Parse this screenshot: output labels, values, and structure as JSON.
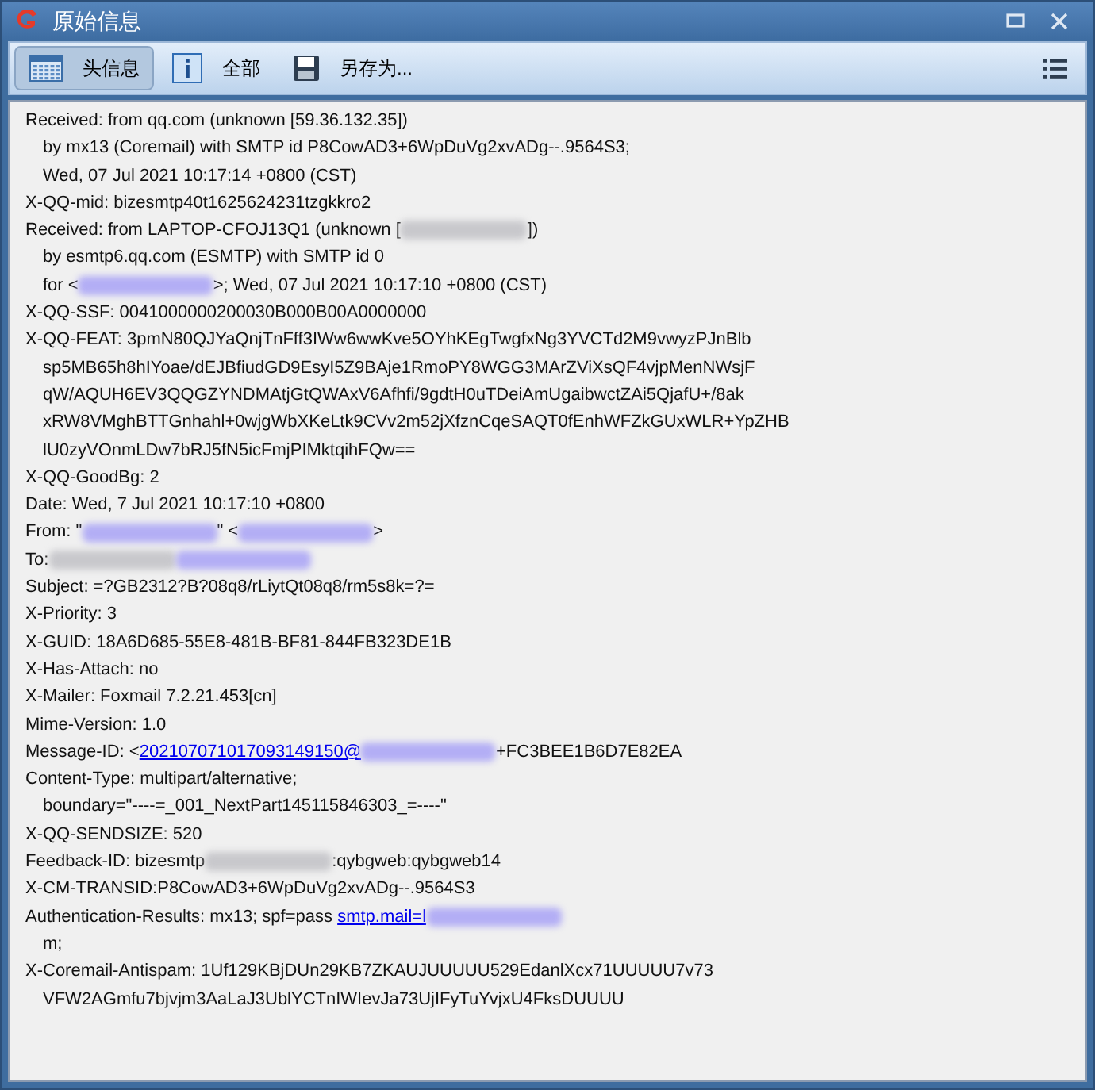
{
  "window": {
    "title": "原始信息"
  },
  "toolbar": [
    {
      "label": "头信息",
      "selected": true
    },
    {
      "label": "全部",
      "selected": false
    },
    {
      "label": "另存为...",
      "selected": false
    }
  ],
  "lines": [
    {
      "indent": false,
      "parts": [
        {
          "kind": "text",
          "text": "Received: from qq.com (unknown [59.36.132.35])"
        }
      ]
    },
    {
      "indent": true,
      "parts": [
        {
          "kind": "text",
          "text": "by mx13 (Coremail) with SMTP id P8CowAD3+6WpDuVg2xvADg--.9564S3;"
        }
      ]
    },
    {
      "indent": true,
      "parts": [
        {
          "kind": "text",
          "text": "Wed, 07 Jul 2021 10:17:14 +0800 (CST)"
        }
      ]
    },
    {
      "indent": false,
      "parts": [
        {
          "kind": "text",
          "text": "X-QQ-mid: bizesmtp40t1625624231tzgkkro2"
        }
      ]
    },
    {
      "indent": false,
      "parts": [
        {
          "kind": "text",
          "text": "Received: from LAPTOP-CFOJ13Q1 (unknown ["
        },
        {
          "kind": "blur"
        },
        {
          "kind": "text",
          "text": "])"
        }
      ]
    },
    {
      "indent": true,
      "parts": [
        {
          "kind": "text",
          "text": "by esmtp6.qq.com (ESMTP) with SMTP id 0"
        }
      ]
    },
    {
      "indent": true,
      "parts": [
        {
          "kind": "text",
          "text": "for <"
        },
        {
          "kind": "blur-link"
        },
        {
          "kind": "text",
          "text": ">; Wed, 07 Jul 2021 10:17:10 +0800 (CST)"
        }
      ]
    },
    {
      "indent": false,
      "parts": [
        {
          "kind": "text",
          "text": "X-QQ-SSF: 0041000000200030B000B00A0000000"
        }
      ]
    },
    {
      "indent": false,
      "parts": [
        {
          "kind": "text",
          "text": "X-QQ-FEAT: 3pmN80QJYaQnjTnFff3IWw6wwKve5OYhKEgTwgfxNg3YVCTd2M9vwyzPJnBlb"
        }
      ]
    },
    {
      "indent": true,
      "parts": [
        {
          "kind": "text",
          "text": "sp5MB65h8hIYoae/dEJBfiudGD9EsyI5Z9BAje1RmoPY8WGG3MArZViXsQF4vjpMenNWsjF"
        }
      ]
    },
    {
      "indent": true,
      "parts": [
        {
          "kind": "text",
          "text": "qW/AQUH6EV3QQGZYNDMAtjGtQWAxV6Afhfi/9gdtH0uTDeiAmUgaibwctZAi5QjafU+/8ak"
        }
      ]
    },
    {
      "indent": true,
      "parts": [
        {
          "kind": "text",
          "text": "xRW8VMghBTTGnhahl+0wjgWbXKeLtk9CVv2m52jXfznCqeSAQT0fEnhWFZkGUxWLR+YpZHB"
        }
      ]
    },
    {
      "indent": true,
      "parts": [
        {
          "kind": "text",
          "text": "lU0zyVOnmLDw7bRJ5fN5icFmjPIMktqihFQw=="
        }
      ]
    },
    {
      "indent": false,
      "parts": [
        {
          "kind": "text",
          "text": "X-QQ-GoodBg: 2"
        }
      ]
    },
    {
      "indent": false,
      "parts": [
        {
          "kind": "text",
          "text": "Date: Wed, 7 Jul 2021 10:17:10 +0800"
        }
      ]
    },
    {
      "indent": false,
      "parts": [
        {
          "kind": "text",
          "text": "From: \""
        },
        {
          "kind": "blur-link"
        },
        {
          "kind": "text",
          "text": "\" <"
        },
        {
          "kind": "blur-link"
        },
        {
          "kind": "text",
          "text": ">"
        }
      ]
    },
    {
      "indent": false,
      "parts": [
        {
          "kind": "text",
          "text": "To:"
        },
        {
          "kind": "blur"
        },
        {
          "kind": "blur-link"
        }
      ]
    },
    {
      "indent": false,
      "parts": [
        {
          "kind": "text",
          "text": "Subject: =?GB2312?B?08q8/rLiytQt08q8/rm5s8k=?="
        }
      ]
    },
    {
      "indent": false,
      "parts": [
        {
          "kind": "text",
          "text": "X-Priority: 3"
        }
      ]
    },
    {
      "indent": false,
      "parts": [
        {
          "kind": "text",
          "text": "X-GUID: 18A6D685-55E8-481B-BF81-844FB323DE1B"
        }
      ]
    },
    {
      "indent": false,
      "parts": [
        {
          "kind": "text",
          "text": "X-Has-Attach: no"
        }
      ]
    },
    {
      "indent": false,
      "parts": [
        {
          "kind": "text",
          "text": "X-Mailer: Foxmail 7.2.21.453[cn]"
        }
      ]
    },
    {
      "indent": false,
      "parts": [
        {
          "kind": "text",
          "text": "Mime-Version: 1.0"
        }
      ]
    },
    {
      "indent": false,
      "parts": [
        {
          "kind": "text",
          "text": "Message-ID: <"
        },
        {
          "kind": "link",
          "text": "202107071017093149150@"
        },
        {
          "kind": "blur-link"
        },
        {
          "kind": "text",
          "text": "+FC3BEE1B6D7E82EA"
        }
      ]
    },
    {
      "indent": false,
      "parts": [
        {
          "kind": "text",
          "text": "Content-Type: multipart/alternative;"
        }
      ]
    },
    {
      "indent": true,
      "parts": [
        {
          "kind": "text",
          "text": "boundary=\"----=_001_NextPart145115846303_=----\""
        }
      ]
    },
    {
      "indent": false,
      "parts": [
        {
          "kind": "text",
          "text": "X-QQ-SENDSIZE: 520"
        }
      ]
    },
    {
      "indent": false,
      "parts": [
        {
          "kind": "text",
          "text": "Feedback-ID: bizesmtp"
        },
        {
          "kind": "blur"
        },
        {
          "kind": "text",
          "text": ":qybgweb:qybgweb14"
        }
      ]
    },
    {
      "indent": false,
      "parts": [
        {
          "kind": "text",
          "text": "X-CM-TRANSID:P8CowAD3+6WpDuVg2xvADg--.9564S3"
        }
      ]
    },
    {
      "indent": false,
      "parts": [
        {
          "kind": "text",
          "text": "Authentication-Results: mx13; spf=pass "
        },
        {
          "kind": "link",
          "text": "smtp.mail=l"
        },
        {
          "kind": "blur-link"
        }
      ]
    },
    {
      "indent": true,
      "parts": [
        {
          "kind": "text",
          "text": "m;"
        }
      ]
    },
    {
      "indent": false,
      "parts": [
        {
          "kind": "text",
          "text": "X-Coremail-Antispam: 1Uf129KBjDUn29KB7ZKAUJUUUUU529EdanlXcx71UUUUU7v73"
        }
      ]
    },
    {
      "indent": true,
      "parts": [
        {
          "kind": "text",
          "text": "VFW2AGmfu7bjvjm3AaLaJ3UblYCTnIWIevJa73UjIFyTuYvjxU4FksDUUUU"
        }
      ]
    }
  ]
}
